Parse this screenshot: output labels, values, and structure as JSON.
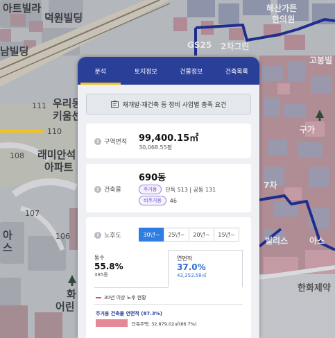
{
  "map": {
    "labels": {
      "top_left_partial": "아트빌라",
      "deokwon": "덕원빌딩",
      "namvilla": "남빌딩",
      "woori_line1": "우리동",
      "woori_line2": "키움센",
      "num111": "111",
      "num110": "110",
      "num108": "108",
      "num107": "107",
      "num106": "106",
      "raemian_line1": "래미안석",
      "raemian_line2": "아파트",
      "a_line1": "아",
      "a_line2": "스",
      "hwa_line1": "화",
      "hwa_line2": "어린",
      "haesan_line1": "해산가든",
      "haesan_line2": "한의원",
      "gs25": "GS25",
      "second_partial": "2차그린",
      "gobong": "고봉빌",
      "guga": "구가",
      "hanhwa": "한화제약",
      "villa_partial": "빌리스",
      "aseu": "아스",
      "tower": "7차"
    },
    "colors": {
      "boundary": "#1f2e8c",
      "road_highlight": "#f2c31b"
    }
  },
  "panel": {
    "tabs": [
      {
        "label": "분석",
        "active": true
      },
      {
        "label": "토지정보",
        "active": false
      },
      {
        "label": "건물정보",
        "active": false
      },
      {
        "label": "건축목록",
        "active": false
      }
    ],
    "plan_button_label": "재개발·재건축 등 정비 사업별 충족 요건",
    "area": {
      "label": "구역면적",
      "value": "99,400.15㎡",
      "sub": "30,068.55평"
    },
    "buildings": {
      "label": "건축물",
      "value": "690동",
      "residential_badge": "주거용",
      "residential_text": "단독 513 | 공동 131",
      "nonresidential_badge": "비주거용",
      "nonresidential_text": "46"
    },
    "aging": {
      "label": "노후도",
      "segments": [
        {
          "label": "30년~",
          "active": true
        },
        {
          "label": "25년~",
          "active": false
        },
        {
          "label": "20년~",
          "active": false
        },
        {
          "label": "15년~",
          "active": false
        }
      ],
      "count_title": "동수",
      "count_pct": "55.8%",
      "count_sub": "385동",
      "area_title": "연면적",
      "area_pct": "37.0%",
      "area_sub": "43,353.58㎡",
      "legend": "30년 이상 노후 현황",
      "residential_heading": "주거용 건축물 연면적 (87.3%)",
      "detached_text": "단독주택: 32,879.02㎡(86.7%)"
    },
    "colors": {
      "tab_bg": "#2a3f97",
      "active_underline": "#f2c31b",
      "segment_active": "#2f7de0",
      "pct_blue": "#2f6fd1",
      "legend_red": "#e05050"
    }
  }
}
